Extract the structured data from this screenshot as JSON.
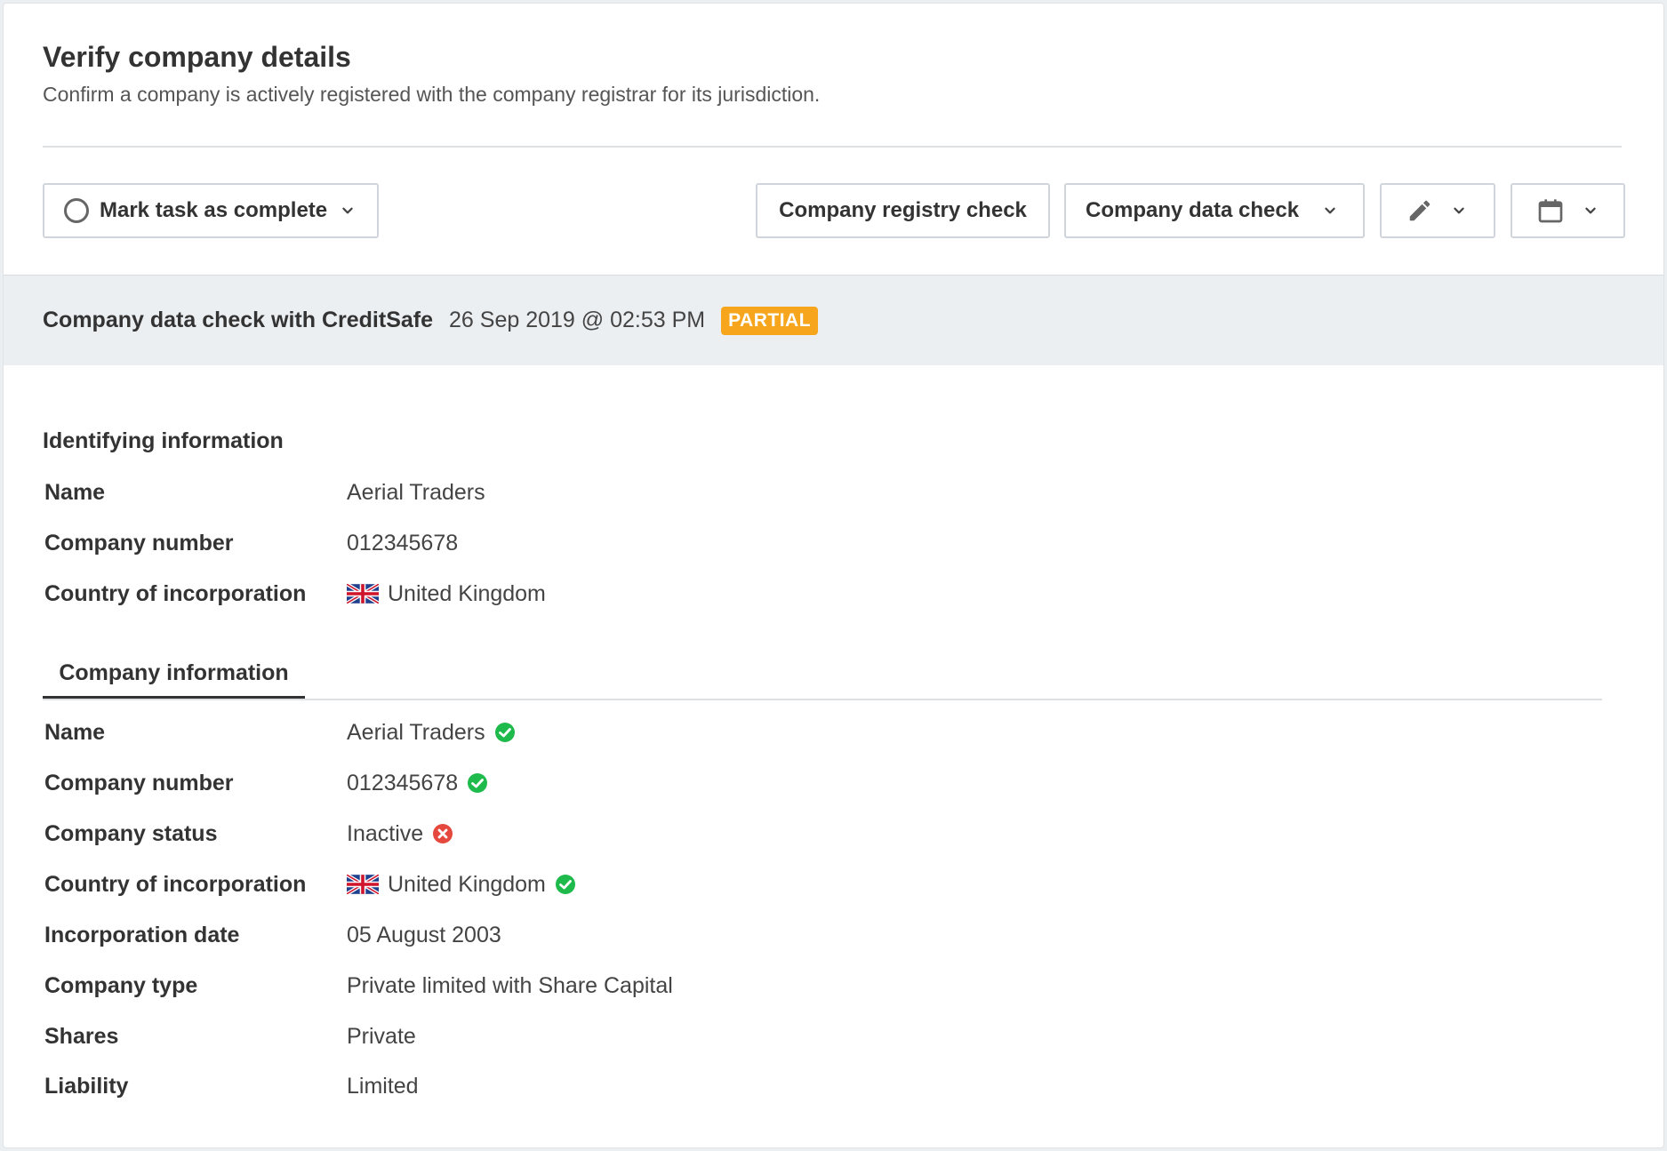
{
  "header": {
    "title": "Verify company details",
    "subtitle": "Confirm a company is actively registered with the company registrar for its jurisdiction."
  },
  "toolbar": {
    "mark_complete_label": "Mark task as complete",
    "registry_check_label": "Company registry check",
    "data_check_label": "Company data check"
  },
  "check": {
    "title": "Company data check with CreditSafe",
    "date": "26 Sep 2019 @ 02:53 PM",
    "status": "PARTIAL",
    "status_color": "#f7a51c"
  },
  "identifying": {
    "title": "Identifying information",
    "rows": [
      {
        "label": "Name",
        "value": "Aerial Traders"
      },
      {
        "label": "Company number",
        "value": "012345678"
      },
      {
        "label": "Country of incorporation",
        "value": "United Kingdom",
        "flag": "uk-flag-icon"
      }
    ]
  },
  "tabs": {
    "company_info": "Company information"
  },
  "company": {
    "rows": [
      {
        "label": "Name",
        "value": "Aerial Traders",
        "status": "match"
      },
      {
        "label": "Company number",
        "value": "012345678",
        "status": "match"
      },
      {
        "label": "Company status",
        "value": "Inactive",
        "status": "mismatch"
      },
      {
        "label": "Country of incorporation",
        "value": "United Kingdom",
        "status": "match",
        "flag": "uk-flag-icon"
      },
      {
        "label": "Incorporation date",
        "value": "05 August 2003"
      },
      {
        "label": "Company type",
        "value": "Private limited with Share Capital"
      },
      {
        "label": "Shares",
        "value": "Private"
      },
      {
        "label": "Liability",
        "value": "Limited"
      }
    ]
  },
  "colors": {
    "match": "#1fba4c",
    "mismatch": "#e5483c"
  }
}
